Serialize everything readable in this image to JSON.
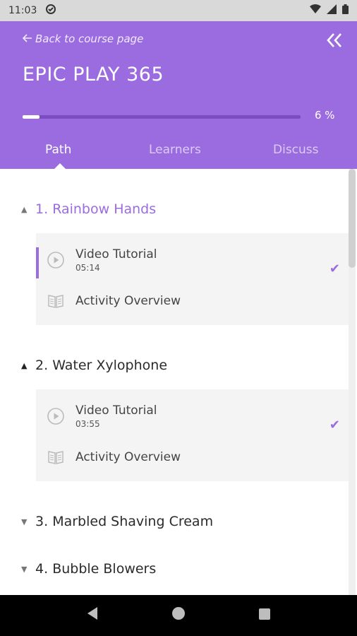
{
  "status_bar": {
    "time": "11:03"
  },
  "header": {
    "back_label": "Back to course page",
    "course_title": "EPIC PLAY 365",
    "progress_percent": 6,
    "progress_label": "6 %",
    "accent_color": "#9b6be0"
  },
  "tabs": [
    {
      "label": "Path",
      "active": true
    },
    {
      "label": "Learners",
      "active": false
    },
    {
      "label": "Discuss",
      "active": false
    }
  ],
  "sections": [
    {
      "number": "1.",
      "title": "Rainbow Hands",
      "expanded": true,
      "lessons": [
        {
          "title": "Video Tutorial",
          "duration": "05:14",
          "icon": "play-icon",
          "completed": true
        },
        {
          "title": "Activity Overview",
          "icon": "book-icon"
        }
      ]
    },
    {
      "number": "2.",
      "title": "Water Xylophone",
      "expanded": true,
      "lessons": [
        {
          "title": "Video Tutorial",
          "duration": "03:55",
          "icon": "play-icon",
          "completed": true
        },
        {
          "title": "Activity Overview",
          "icon": "book-icon"
        }
      ]
    },
    {
      "number": "3.",
      "title": "Marbled Shaving Cream",
      "expanded": false
    },
    {
      "number": "4.",
      "title": "Bubble Blowers",
      "expanded": false
    }
  ]
}
